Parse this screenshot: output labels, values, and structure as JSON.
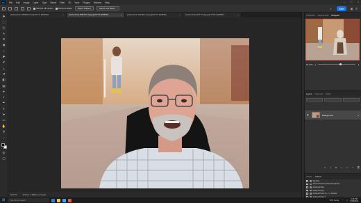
{
  "app": {
    "logo": "Ps",
    "menu": [
      "File",
      "Edit",
      "Image",
      "Layer",
      "Type",
      "Select",
      "Filter",
      "3D",
      "View",
      "Plugins",
      "Window",
      "Help"
    ]
  },
  "options_bar": {
    "sample_all_layers": "Sample All Layers",
    "enhance_edge": "Enhance Edge",
    "select_subject": "Select Subject",
    "select_and_mask": "Select and Mask...",
    "share": "Share"
  },
  "tabs": [
    {
      "label": "pexels-photo-1805000-t4.tif @ 66.7% (RGB/8#)",
      "active": false
    },
    {
      "label": "pexels-photo-1581320-v4.jpg @ 66.7% (RGB/8#)",
      "active": true
    },
    {
      "label": "pexels-photo-1637947-y4.jpg @ 66.7% (RGB/8#)",
      "active": false
    },
    {
      "label": "pexels-photo-2671775-d.jpg @ 56.6% (RGB/8#)",
      "active": false
    }
  ],
  "status": {
    "zoom": "66.67%",
    "doc_info": "4213 px × 2809 px (72 ppi)"
  },
  "right_panel": {
    "tabs": [
      "Properties",
      "Adjustments",
      "Navigator"
    ],
    "active_tab": "Navigator",
    "zoom": "66.67%",
    "zoom_level": 0.6
  },
  "layers": {
    "tabs": [
      "Layers",
      "Channels",
      "Paths"
    ],
    "items": [
      {
        "name": "Background",
        "locked": true
      }
    ]
  },
  "actions": {
    "tabs": [
      "History",
      "Actions"
    ],
    "items": [
      {
        "name": "Vignette"
      },
      {
        "name": "Actions Panel to Photoshop Elem..."
      },
      {
        "name": "Antique Photo"
      },
      {
        "name": "Antique Photo"
      },
      {
        "name": "Antique Photo 2 + T + Vertical"
      },
      {
        "name": "Antique Photo 2"
      },
      {
        "name": "Antique Photo"
      }
    ]
  },
  "taskbar": {
    "search_placeholder": "Type here to search",
    "weather": "79°F Sunny",
    "time": "4:36 PM",
    "date": "5/18/2022"
  },
  "colors": {
    "accent": "#1473e6",
    "panel_bg": "#323232",
    "app_bg": "#262626"
  }
}
